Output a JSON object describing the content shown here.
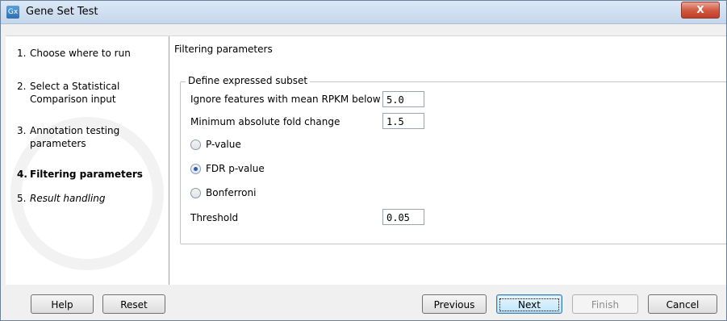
{
  "window": {
    "title": "Gene Set Test",
    "icon_text": "Gx",
    "close_label": "X"
  },
  "steps": [
    {
      "num": "1.",
      "label": "Choose where to run",
      "style": "normal"
    },
    {
      "num": "2.",
      "label": "Select a Statistical Comparison input",
      "style": "normal"
    },
    {
      "num": "3.",
      "label": "Annotation testing parameters",
      "style": "normal"
    },
    {
      "num": "4.",
      "label": "Filtering parameters",
      "style": "bold"
    },
    {
      "num": "5.",
      "label": "Result handling",
      "style": "italic"
    }
  ],
  "panel": {
    "title": "Filtering parameters",
    "group_title": "Define expressed subset",
    "ignore_label": "Ignore features with mean RPKM below",
    "ignore_value": "5.0",
    "fold_label": "Minimum absolute fold change",
    "fold_value": "1.5",
    "radios": [
      {
        "label": "P-value",
        "checked": false
      },
      {
        "label": "FDR p-value",
        "checked": true
      },
      {
        "label": "Bonferroni",
        "checked": false
      }
    ],
    "threshold_label": "Threshold",
    "threshold_value": "0.05"
  },
  "footer": {
    "help": "Help",
    "reset": "Reset",
    "previous": "Previous",
    "next": "Next",
    "finish": "Finish",
    "cancel": "Cancel"
  },
  "colors": {
    "titlebar": "#c5d7ec",
    "close_button": "#c13d26",
    "radio_selected": "#2a5ea8"
  }
}
